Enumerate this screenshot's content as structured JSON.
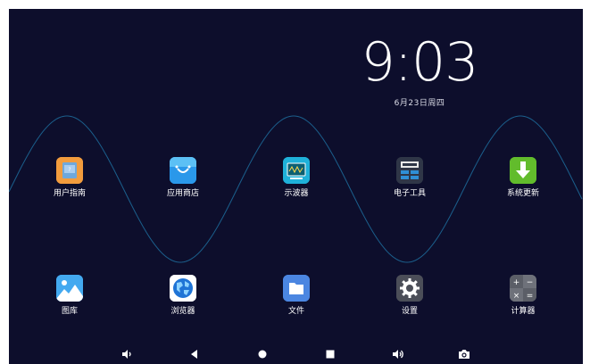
{
  "clock": {
    "time": "9:03",
    "date": "6月23日周四"
  },
  "apps": [
    {
      "label": "用户指南",
      "icon": "user-guide-icon"
    },
    {
      "label": "应用商店",
      "icon": "app-store-icon"
    },
    {
      "label": "示波器",
      "icon": "oscilloscope-icon"
    },
    {
      "label": "电子工具",
      "icon": "electronic-tools-icon"
    },
    {
      "label": "系统更新",
      "icon": "system-update-icon"
    },
    {
      "label": "图库",
      "icon": "gallery-icon"
    },
    {
      "label": "浏览器",
      "icon": "browser-icon"
    },
    {
      "label": "文件",
      "icon": "files-icon"
    },
    {
      "label": "设置",
      "icon": "settings-icon"
    },
    {
      "label": "计算器",
      "icon": "calculator-icon"
    }
  ],
  "navbar": [
    "volume-down-icon",
    "back-icon",
    "home-icon",
    "recents-icon",
    "volume-up-icon",
    "screenshot-icon"
  ],
  "colors": {
    "background": "#0d0e2c",
    "wave": "#1b5f8c"
  }
}
